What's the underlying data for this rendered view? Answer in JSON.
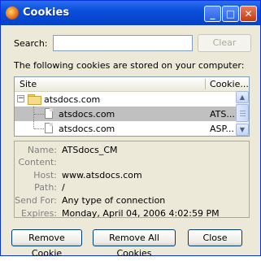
{
  "window": {
    "title": "Cookies",
    "controls": {
      "minimize": "_",
      "maximize": "□",
      "close": "✕"
    }
  },
  "search": {
    "label": "Search:",
    "value": "",
    "clear_label": "Clear"
  },
  "intro_text": "The following cookies are stored on your computer:",
  "tree": {
    "columns": {
      "site": "Site",
      "cookie": "Cookie..."
    },
    "rows": [
      {
        "site": "atsdocs.com",
        "cookie": ""
      },
      {
        "site": "atsdocs.com",
        "cookie": "ATS..."
      },
      {
        "site": "atsdocs.com",
        "cookie": "ASP..."
      }
    ]
  },
  "details": {
    "name_label": "Name:",
    "name_value": "ATSdocs_CM",
    "content_label": "Content:",
    "content_value": "",
    "host_label": "Host:",
    "host_value": "www.atsdocs.com",
    "path_label": "Path:",
    "path_value": "/",
    "sendfor_label": "Send For:",
    "sendfor_value": "Any type of connection",
    "expires_label": "Expires:",
    "expires_value": "Monday, April 04, 2006 4:02:59 PM"
  },
  "buttons": {
    "remove_cookie": "Remove Cookie",
    "remove_all": "Remove All Cookies",
    "close": "Close"
  }
}
